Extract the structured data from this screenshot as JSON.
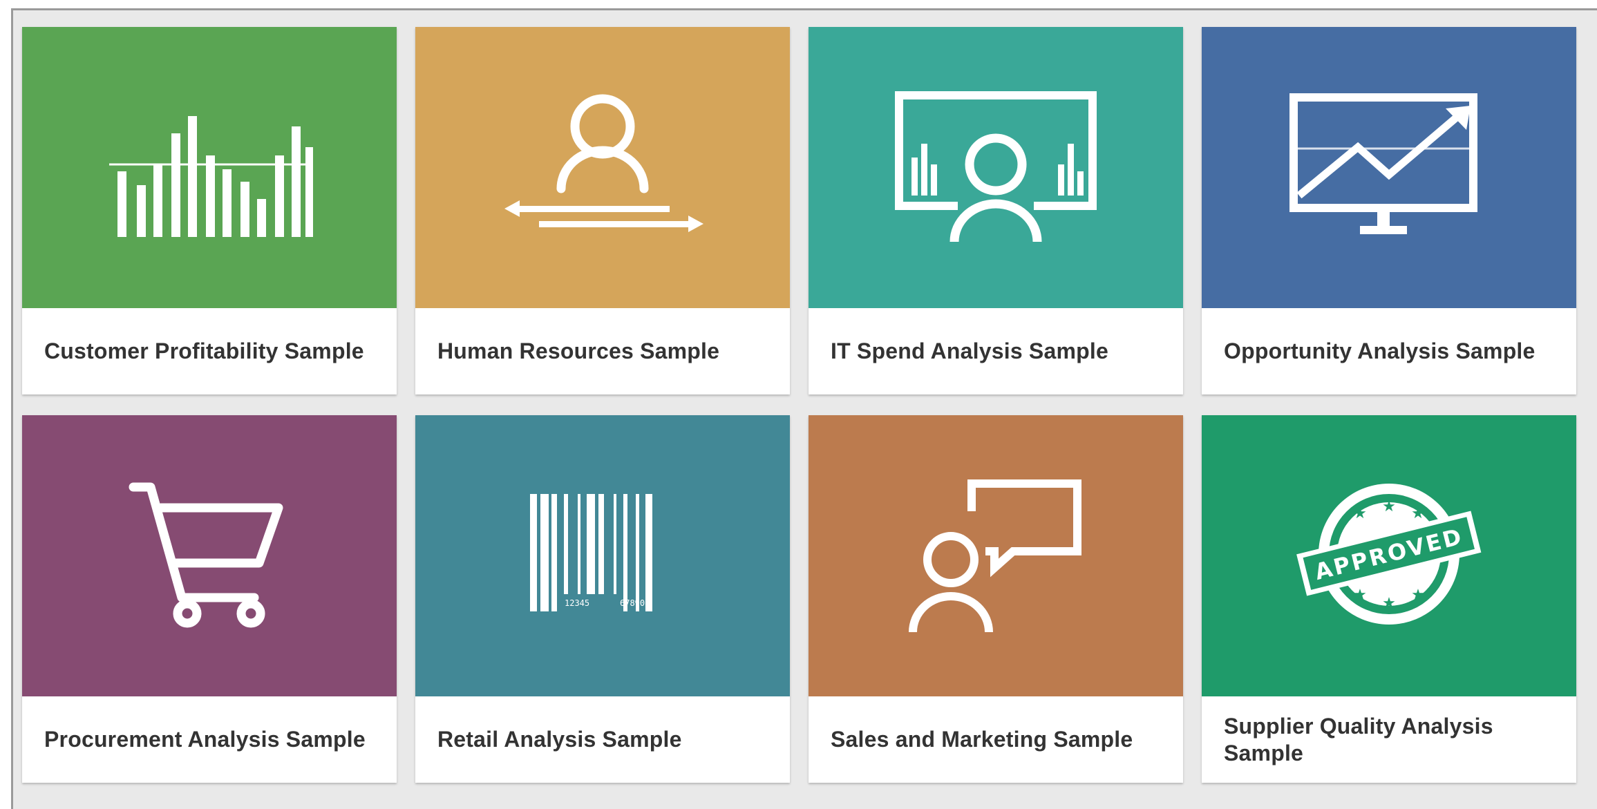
{
  "tiles": [
    {
      "label": "Customer Profitability Sample",
      "color": "#5aa553",
      "icon": "bar-chart-icon"
    },
    {
      "label": "Human Resources Sample",
      "color": "#d5a55a",
      "icon": "person-transfer-icon"
    },
    {
      "label": "IT Spend Analysis Sample",
      "color": "#3aa898",
      "icon": "presentation-screen-icon"
    },
    {
      "label": "Opportunity Analysis Sample",
      "color": "#466da3",
      "icon": "monitor-trend-icon"
    },
    {
      "label": "Procurement Analysis Sample",
      "color": "#864b72",
      "icon": "shopping-cart-icon"
    },
    {
      "label": "Retail Analysis Sample",
      "color": "#428896",
      "icon": "barcode-icon"
    },
    {
      "label": "Sales and Marketing Sample",
      "color": "#bc7b4e",
      "icon": "person-speech-icon"
    },
    {
      "label": "Supplier Quality Analysis Sample",
      "color": "#1f9b6a",
      "icon": "approved-stamp-icon",
      "stamp_text": "APPROVED"
    }
  ],
  "barcode": {
    "left_digits": "12345",
    "right_digits": "67890"
  }
}
